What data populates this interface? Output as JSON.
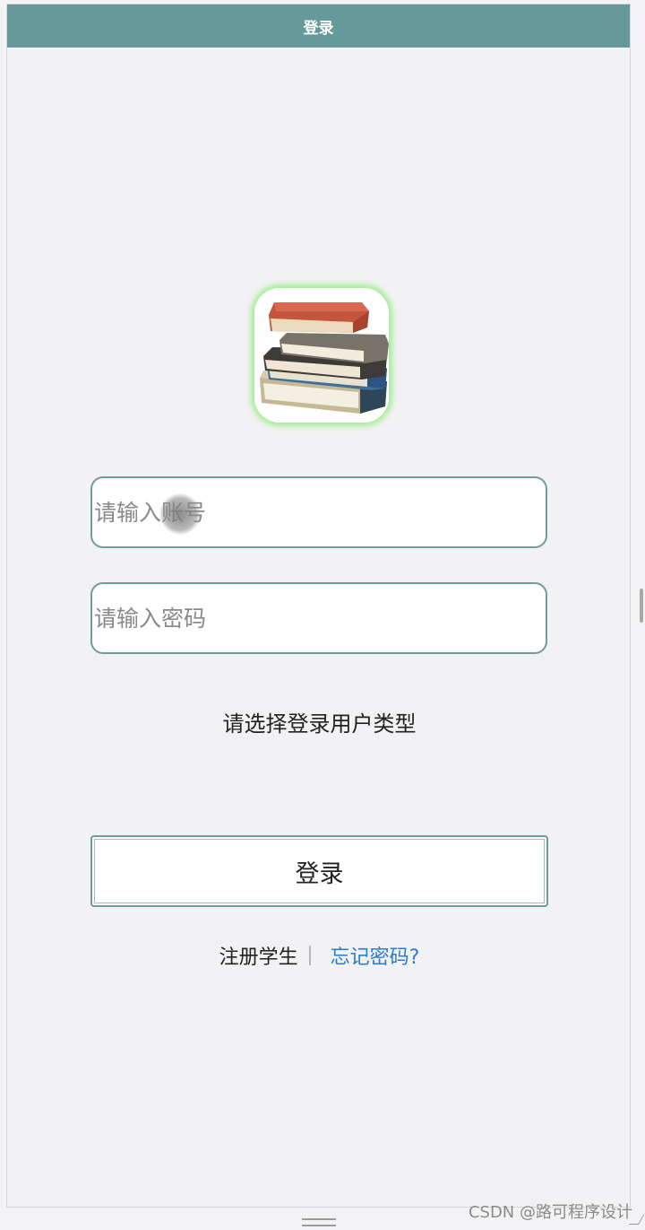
{
  "header": {
    "title": "登录"
  },
  "logo": {
    "icon": "stack-of-books"
  },
  "form": {
    "account_placeholder": "请输入账号",
    "account_value": "",
    "password_placeholder": "请输入密码",
    "password_value": "",
    "user_type_prompt": "请选择登录用户类型",
    "login_label": "登录"
  },
  "footer_links": {
    "register_label": "注册学生",
    "forgot_label": "忘记密码?"
  },
  "watermark": "CSDN @路可程序设计",
  "colors": {
    "header_bg": "#669999",
    "input_border": "#719b9d",
    "link_blue": "#2b7bd4",
    "logo_glow": "#a6ef98",
    "page_bg": "#f2f1f3"
  }
}
